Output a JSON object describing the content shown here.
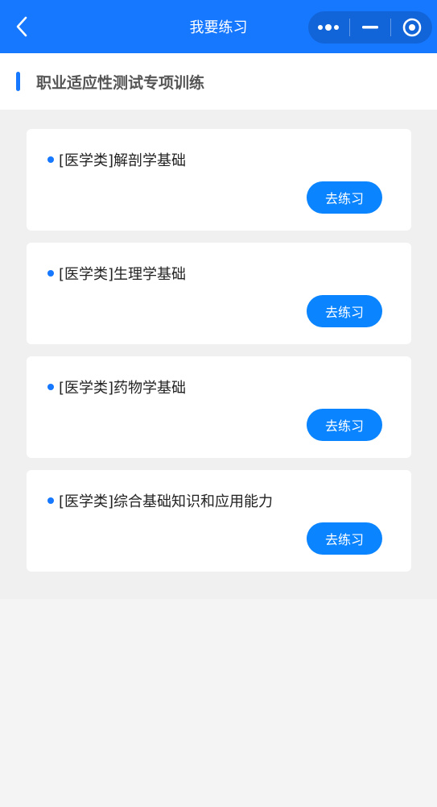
{
  "header": {
    "title": "我要练习",
    "back_icon": "chevron-left-icon",
    "capsule": {
      "more_icon": "more-dots-icon",
      "minimize_icon": "minus-icon",
      "close_icon": "target-icon"
    }
  },
  "section": {
    "title": "职业适应性测试专项训练"
  },
  "items": [
    {
      "title": "[医学类]解剖学基础",
      "button": "去练习"
    },
    {
      "title": "[医学类]生理学基础",
      "button": "去练习"
    },
    {
      "title": "[医学类]药物学基础",
      "button": "去练习"
    },
    {
      "title": "[医学类]综合基础知识和应用能力",
      "button": "去练习"
    }
  ],
  "colors": {
    "primary": "#1677ff",
    "button": "#0a84ff",
    "background": "#f4f4f4"
  }
}
